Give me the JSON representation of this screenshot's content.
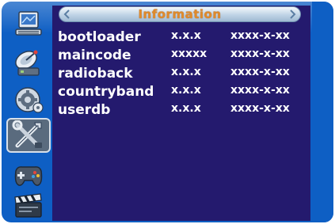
{
  "window": {
    "title": "Information"
  },
  "sidebar": {
    "items": [
      {
        "icon": "computer-icon",
        "selected": false
      },
      {
        "icon": "satellite-dish-icon",
        "selected": false
      },
      {
        "icon": "gears-icon",
        "selected": false
      },
      {
        "icon": "tools-icon",
        "selected": true
      },
      {
        "icon": "gamepad-icon",
        "selected": false
      },
      {
        "icon": "clapperboard-icon",
        "selected": false
      }
    ]
  },
  "info": {
    "rows": [
      {
        "name": "bootloader",
        "version": "x.x.x",
        "date": "xxxx-x-xx"
      },
      {
        "name": "maincode",
        "version": "xxxxx",
        "date": "xxxx-x-xx"
      },
      {
        "name": "radioback",
        "version": "x.x.x",
        "date": "xxxx-x-xx"
      },
      {
        "name": "countryband",
        "version": "x.x.x",
        "date": "xxxx-x-xx"
      },
      {
        "name": "userdb",
        "version": "x.x.x",
        "date": "xxxx-x-xx"
      }
    ]
  },
  "colors": {
    "frame": "#0e5fc4",
    "content_bg": "#241a6e",
    "title_text": "#e08a2b",
    "row_text": "#ffffff"
  }
}
